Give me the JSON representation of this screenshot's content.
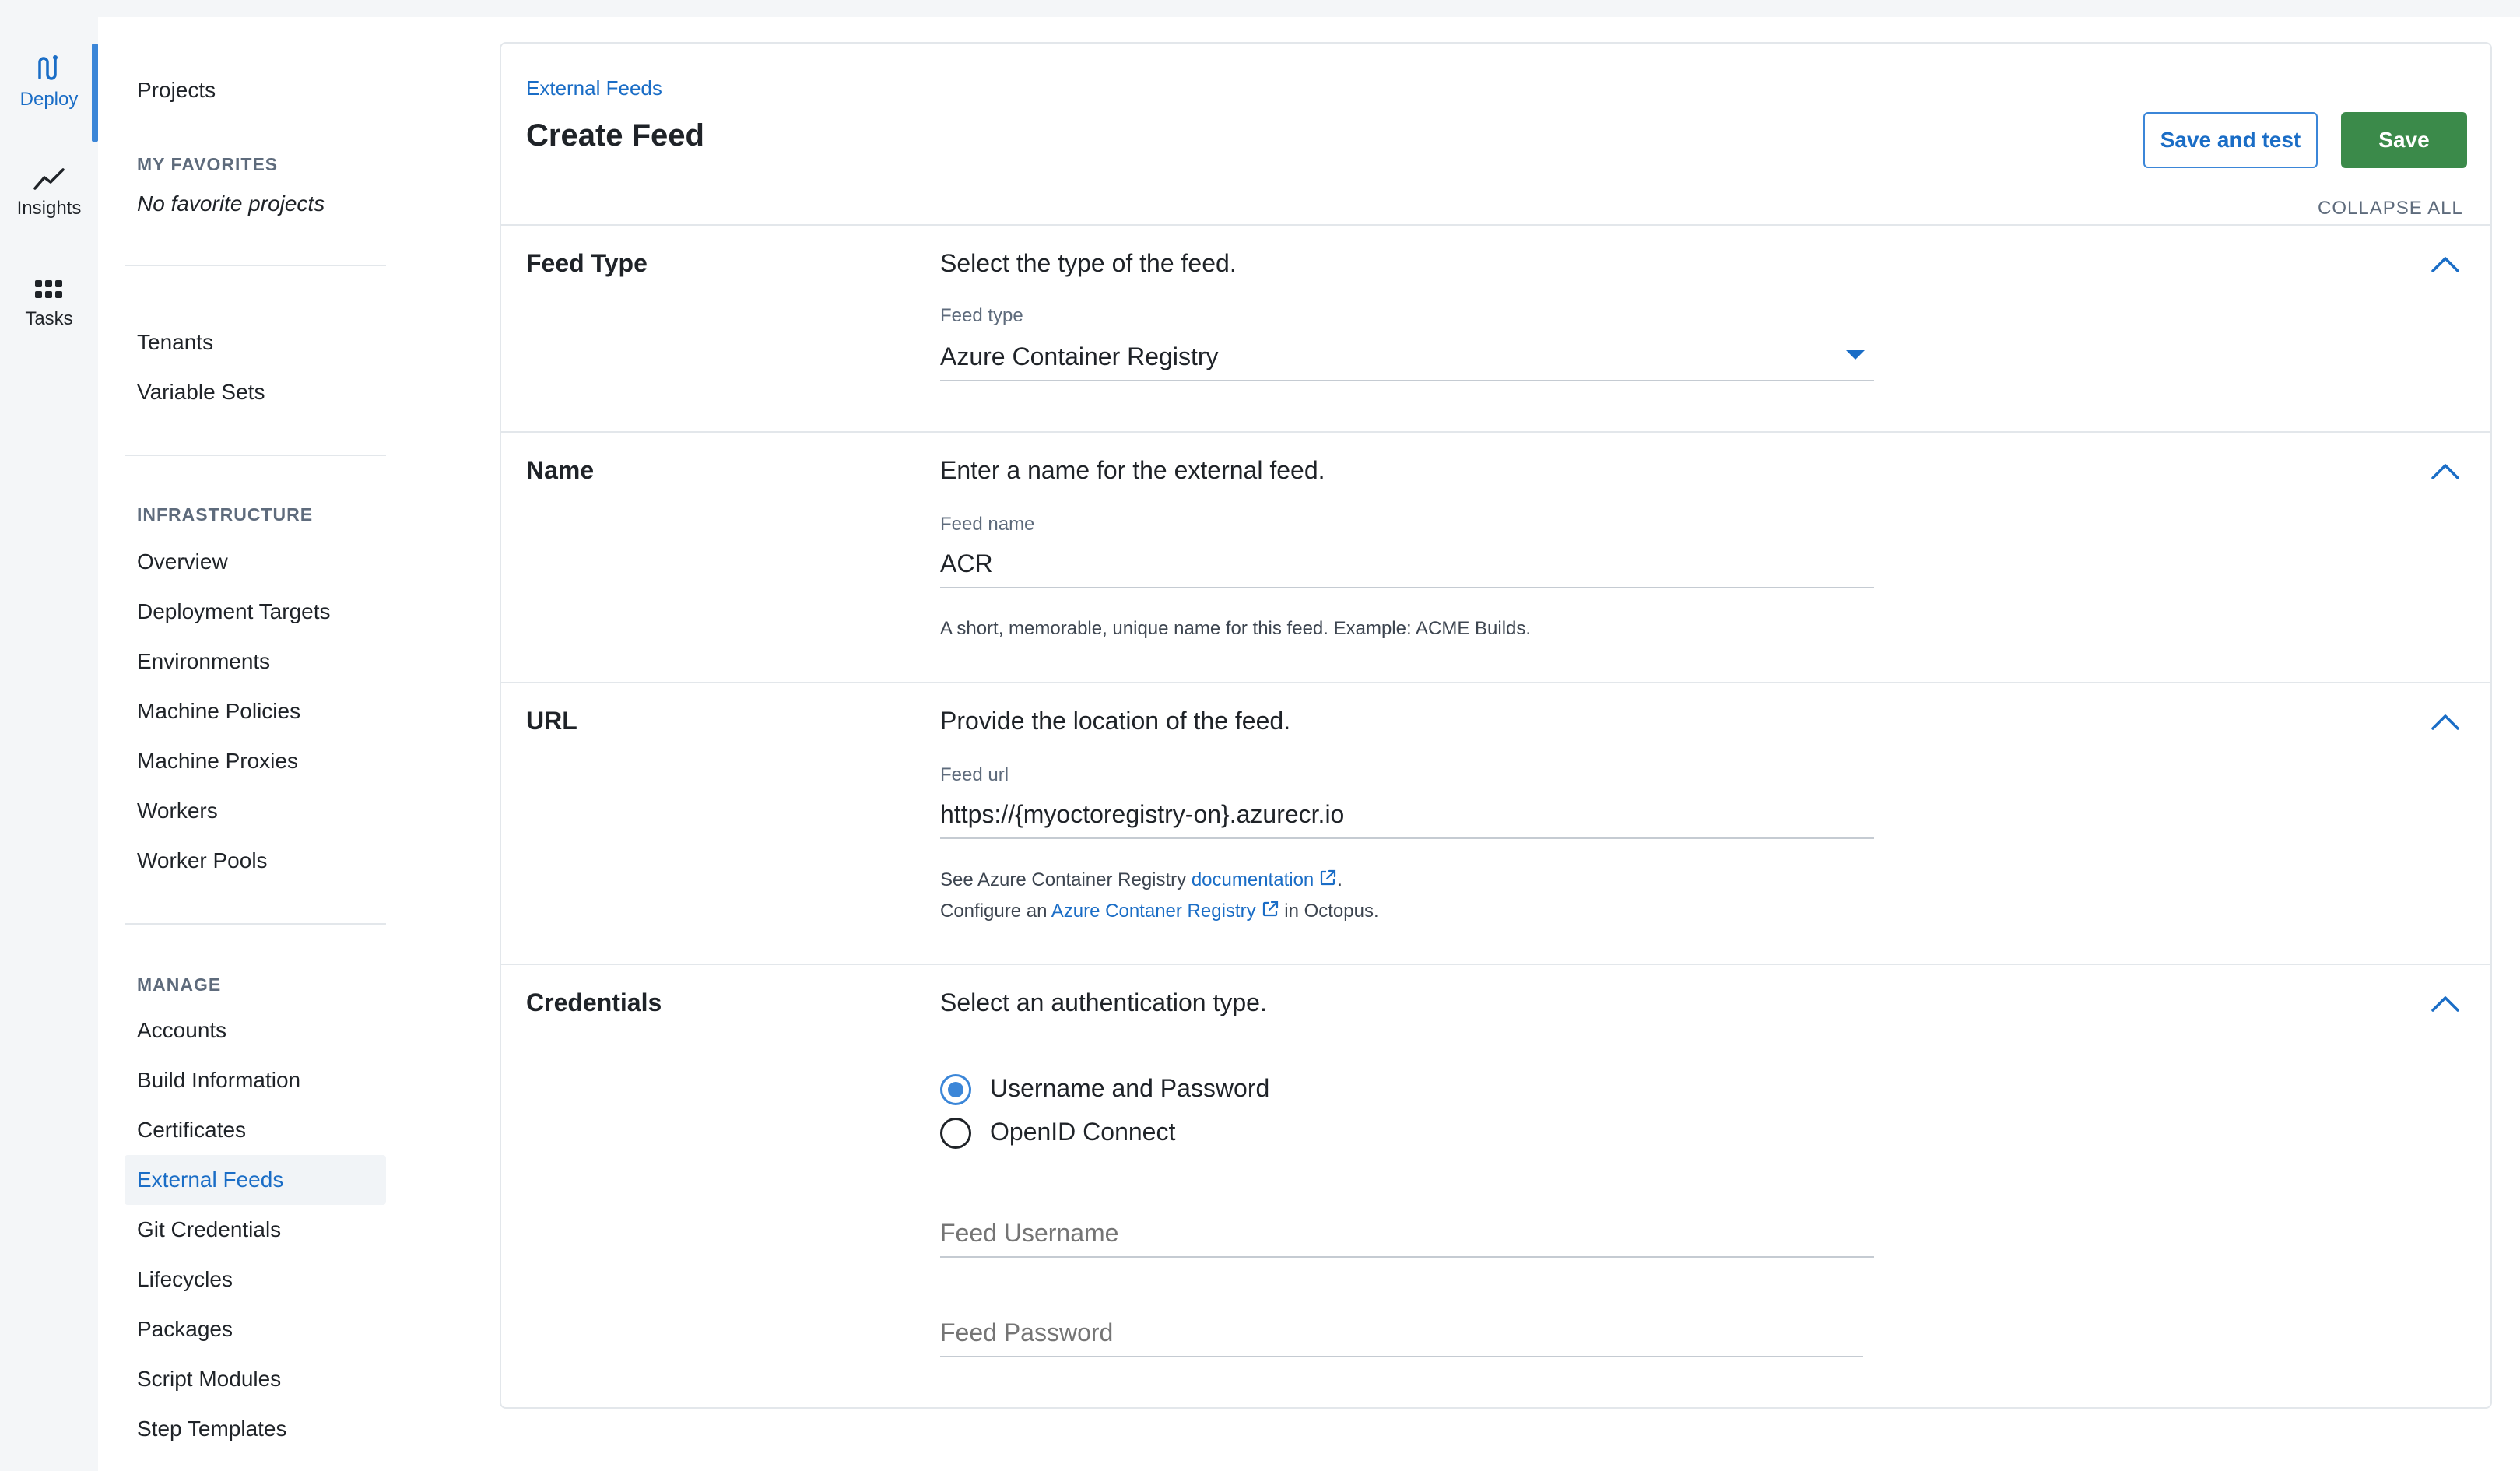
{
  "rail": {
    "items": [
      {
        "label": "Deploy",
        "icon": "deploy-icon"
      },
      {
        "label": "Insights",
        "icon": "trend-line-icon"
      },
      {
        "label": "Tasks",
        "icon": "grid-dots-icon"
      }
    ]
  },
  "sidebar": {
    "projects": "Projects",
    "favorites_heading": "MY FAVORITES",
    "favorites_empty": "No favorite projects",
    "top_links": [
      "Tenants",
      "Variable Sets"
    ],
    "infrastructure_heading": "INFRASTRUCTURE",
    "infrastructure_links": [
      "Overview",
      "Deployment Targets",
      "Environments",
      "Machine Policies",
      "Machine Proxies",
      "Workers",
      "Worker Pools"
    ],
    "manage_heading": "MANAGE",
    "manage_links": [
      "Accounts",
      "Build Information",
      "Certificates",
      "External Feeds",
      "Git Credentials",
      "Lifecycles",
      "Packages",
      "Script Modules",
      "Step Templates"
    ]
  },
  "header": {
    "breadcrumb": "External Feeds",
    "title": "Create Feed",
    "save_and_test_label": "Save and test",
    "save_label": "Save",
    "collapse_all": "COLLAPSE ALL"
  },
  "sections": {
    "feed_type": {
      "title": "Feed Type",
      "description": "Select the type of the feed.",
      "field_label": "Feed type",
      "value": "Azure Container Registry"
    },
    "name": {
      "title": "Name",
      "description": "Enter a name for the external feed.",
      "field_label": "Feed name",
      "value": "ACR",
      "help": "A short, memorable, unique name for this feed. Example: ACME Builds."
    },
    "url": {
      "title": "URL",
      "description": "Provide the location of the feed.",
      "field_label": "Feed url",
      "value": "https://{myoctoregistry-on}.azurecr.io",
      "help1_prefix": "See Azure Container Registry ",
      "help1_link": "documentation",
      "help1_suffix": ".",
      "help2_prefix": "Configure an ",
      "help2_link": "Azure Contaner Registry",
      "help2_suffix": " in Octopus."
    },
    "credentials": {
      "title": "Credentials",
      "description": "Select an authentication type.",
      "options": [
        "Username and Password",
        "OpenID Connect"
      ],
      "selected": "Username and Password",
      "username_placeholder": "Feed Username",
      "password_placeholder": "Feed Password"
    }
  },
  "colors": {
    "accent": "#1a6dc6",
    "save_green": "#3b8a4a"
  }
}
